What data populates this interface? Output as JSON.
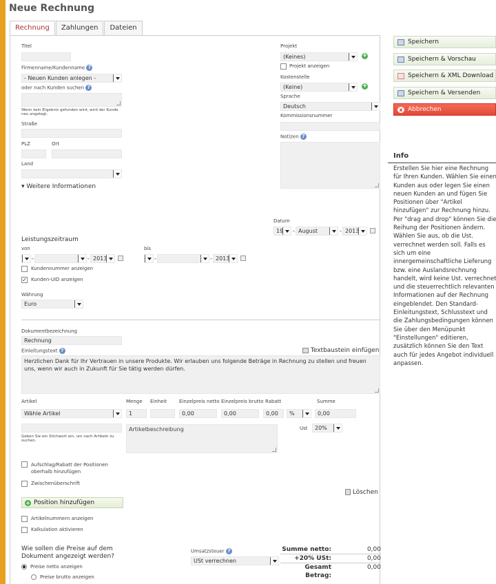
{
  "window": {
    "title": "Neue Rechnung"
  },
  "tabs": [
    {
      "label": "Rechnung"
    },
    {
      "label": "Zahlungen"
    },
    {
      "label": "Dateien"
    }
  ],
  "form": {
    "titel_label": "Titel",
    "firma_label": "Firmenname/Kundenname",
    "firma_value": "- Neuen Kunden anlegen -",
    "suchen_label": "oder nach Kunden suchen",
    "suchen_hint": "Wenn kein Ergebnis gefunden wird, wird der Kunde neu angelegt.",
    "strasse_label": "Straße",
    "plz_label": "PLZ",
    "ort_label": "Ort",
    "land_label": "Land",
    "weitere_label": "Weitere Informationen",
    "projekt_label": "Projekt",
    "projekt_value": "(Keines)",
    "projekt_anzeigen": "Projekt anzeigen",
    "kostenstelle_label": "Kostenstelle",
    "kostenstelle_value": "(Keine)",
    "sprache_label": "Sprache",
    "sprache_value": "Deutsch",
    "kommission_label": "Kommissionsnummer",
    "notizen_label": "Notizen",
    "datum_label": "Datum",
    "datum_day": "19",
    "datum_month": "August",
    "datum_year": "2013",
    "leistung_label": "Leistungszeitraum",
    "von_label": "von",
    "bis_label": "bis",
    "von_year": "2013",
    "bis_year": "2013",
    "kundennummer_label": "Kundennummer anzeigen",
    "kundenuid_label": "Kunden-UID anzeigen",
    "kundenuid_check": "✓",
    "waehrung_label": "Währung",
    "waehrung_value": "Euro",
    "dokbez_label": "Dokumentbezeichnung",
    "dokbez_value": "Rechnung",
    "einleitung_label": "Einleitungstext",
    "textbaustein_label": "Textbaustein einfügen",
    "einleitung_text": "Herzlichen Dank für Ihr Vertrauen in unsere Produkte. Wir erlauben uns folgende Beträge in Rechnung zu stellen und freuen uns, wenn wir auch in Zukunft für Sie tätig werden dürfen."
  },
  "items": {
    "headers": {
      "artikel": "Artikel",
      "menge": "Menge",
      "einheit": "Einheit",
      "netto": "Einzelpreis netto",
      "brutto": "Einzelpreis brutto",
      "rabatt": "Rabatt",
      "summe": "Summe"
    },
    "artikel_value": "Wähle Artikel",
    "menge_value": "1",
    "netto_value": "0,00",
    "brutto_value": "0,00",
    "rabatt_value": "0,00",
    "rabatt_unit": "%",
    "summe_value": "0,00",
    "stichwort_hint": "Geben Sie ein Stichwort ein, um nach Artikeln zu suchen.",
    "beschreibung_placeholder": "Artikelbeschreibung",
    "ust_label": "Ust",
    "ust_value": "20%",
    "aufschlag_label": "Aufschlag/Rabatt der Positionen oberhalb hinzufügen",
    "zwischen_label": "Zwischenüberschrift",
    "loeschen_label": "Löschen",
    "position_button": "Position hinzufügen",
    "artikelnummern_label": "Artikelnummern anzeigen",
    "kalkulation_label": "Kalkulation aktivieren"
  },
  "pricing": {
    "question": "Wie sollen die Preise auf dem Dokument angezeigt werden?",
    "opt_netto": "Preise netto anzeigen",
    "opt_brutto": "Preise brutto anzeigen",
    "umsatz_label": "Umsatzsteuer",
    "umsatz_value": "USt verrechnen"
  },
  "totals": {
    "netto_label": "Summe netto:",
    "netto_value": "0,00",
    "ust_label": "+20% USt:",
    "ust_value": "0,00",
    "gesamt_label": "Gesamt",
    "gesamt_label2": "Betrag:",
    "gesamt_value": "0,00"
  },
  "actions": {
    "save": "Speichern",
    "save_preview": "Speichern & Vorschau",
    "save_xml": "Speichern & XML Download",
    "save_send": "Speichern & Versenden",
    "cancel": "Abbrechen",
    "cancel_icon": "x"
  },
  "info": {
    "title": "Info",
    "text": "Erstellen Sie hier eine Rechnung für Ihren Kunden. Wählen Sie einen Kunden aus oder legen Sie einen neuen Kunden an und fügen Sie Positionen über \"Artikel hinzufügen\" zur Rechnung hinzu. Per \"drag and drop\" können Sie die Reihung der Positionen ändern. Wählen Sie aus, ob die Ust. verrechnet werden soll. Falls es sich um eine innergemeinschaftliche Lieferung bzw. eine Auslandsrechnung handelt, wird keine Ust. verrechnet und die steuerrechtlich relevanten Informationen auf der Rechnung eingeblendet. Den Standard-Einleitungstext, Schlusstext und die Zahlungsbedingungen können Sie über den Menüpunkt \"Einstellungen\" editieren, zusätzlich können Sie den Text auch für jedes Angebot individuell anpassen."
  },
  "icons": {
    "help": "?",
    "plus": "+",
    "dash": "-",
    "check": "✓"
  },
  "colors": {
    "accent": "#a33333",
    "cancel": "#e24a34",
    "frame": "#e8a020"
  }
}
